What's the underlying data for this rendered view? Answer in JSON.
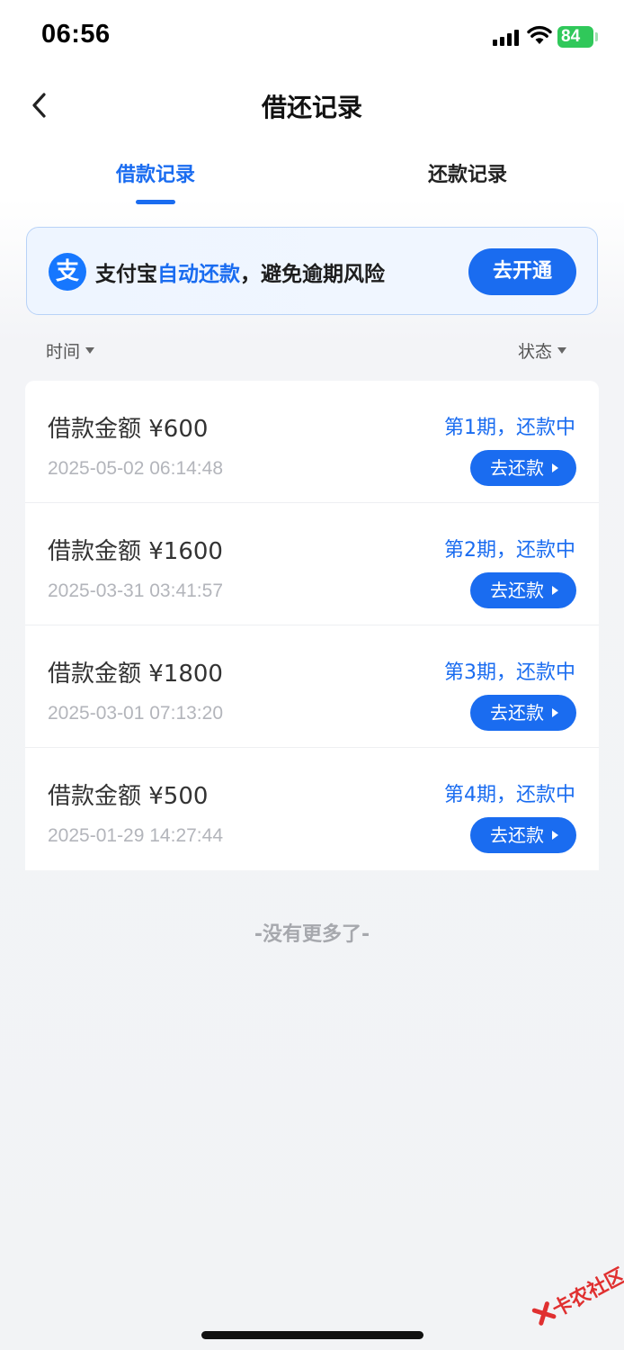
{
  "status_bar": {
    "time": "06:56",
    "battery": "84"
  },
  "header": {
    "title": "借还记录"
  },
  "tabs": [
    {
      "label": "借款记录",
      "active": true
    },
    {
      "label": "还款记录",
      "active": false
    }
  ],
  "banner": {
    "icon": "alipay-icon",
    "icon_glyph": "支",
    "text_prefix": "支付宝",
    "text_highlight": "自动还款",
    "text_suffix": "，避免逾期风险",
    "button_label": "去开通"
  },
  "filters": {
    "time_label": "时间",
    "status_label": "状态"
  },
  "records": [
    {
      "amount": "借款金额 ¥600",
      "datetime": "2025-05-02 06:14:48",
      "period": "第1期，还款中",
      "button": "去还款"
    },
    {
      "amount": "借款金额 ¥1600",
      "datetime": "2025-03-31 03:41:57",
      "period": "第2期，还款中",
      "button": "去还款"
    },
    {
      "amount": "借款金额 ¥1800",
      "datetime": "2025-03-01 07:13:20",
      "period": "第3期，还款中",
      "button": "去还款"
    },
    {
      "amount": "借款金额 ¥500",
      "datetime": "2025-01-29 14:27:44",
      "period": "第4期，还款中",
      "button": "去还款"
    }
  ],
  "footer": {
    "no_more": "-没有更多了-"
  },
  "watermark": {
    "text": "卡农社区"
  },
  "colors": {
    "accent": "#1a6cf0",
    "battery": "#30c85a"
  }
}
